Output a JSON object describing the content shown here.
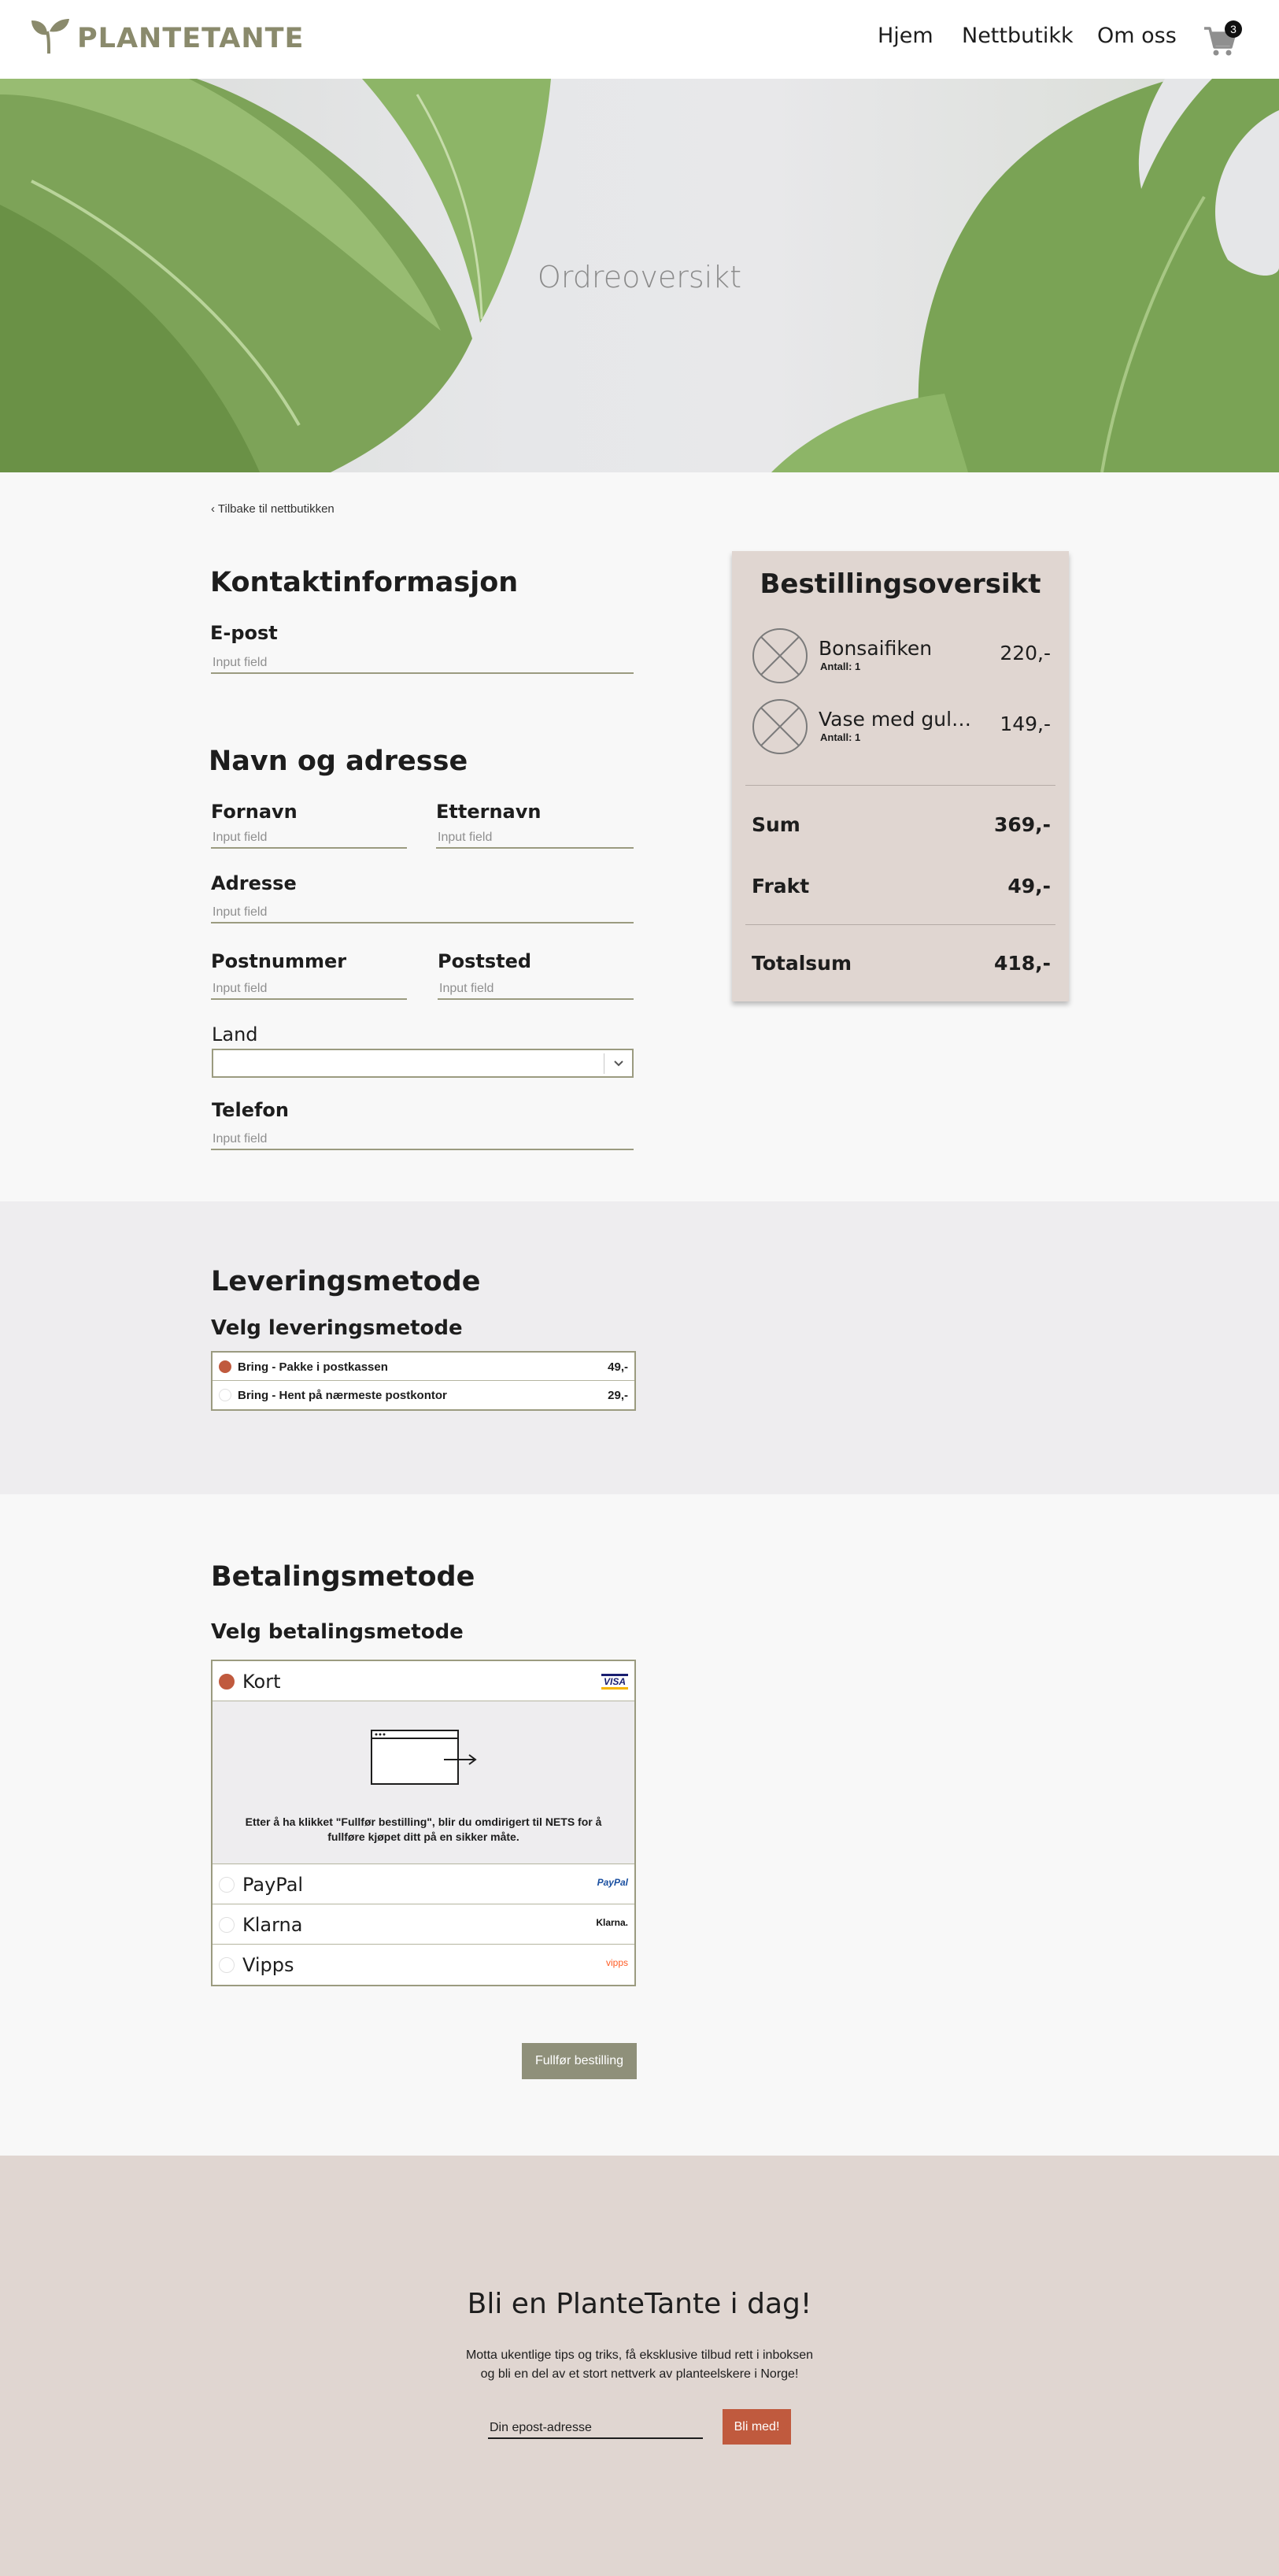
{
  "header": {
    "logo_text": "PLANTETANTE",
    "nav": [
      {
        "label": "Hjem"
      },
      {
        "label": "Nettbutikk"
      },
      {
        "label": "Om oss"
      }
    ],
    "cart_count": "3"
  },
  "hero": {
    "title": "Ordreoversikt"
  },
  "back_link": "Tilbake til nettbutikken",
  "contact": {
    "heading": "Kontaktinformasjon",
    "email_label": "E-post",
    "email_placeholder": "Input field"
  },
  "address": {
    "heading": "Navn og adresse",
    "first_name_label": "Fornavn",
    "last_name_label": "Etternavn",
    "address_label": "Adresse",
    "postal_code_label": "Postnummer",
    "city_label": "Poststed",
    "country_label": "Land",
    "phone_label": "Telefon",
    "placeholder": "Input field"
  },
  "summary": {
    "title": "Bestillingsoversikt",
    "items": [
      {
        "name": "Bonsaifiken",
        "qty": "Antall: 1",
        "price": "220,-"
      },
      {
        "name": "Vase med gull...",
        "qty": "Antall: 1",
        "price": "149,-"
      }
    ],
    "sum_label": "Sum",
    "sum_value": "369,-",
    "shipping_label": "Frakt",
    "shipping_value": "49,-",
    "total_label": "Totalsum",
    "total_value": "418,-"
  },
  "delivery": {
    "heading": "Leveringsmetode",
    "subheading": "Velg leveringsmetode",
    "options": [
      {
        "label": "Bring - Pakke i postkassen",
        "price": "49,-",
        "selected": true
      },
      {
        "label": "Bring - Hent på nærmeste postkontor",
        "price": "29,-",
        "selected": false
      }
    ]
  },
  "payment": {
    "heading": "Betalingsmetode",
    "subheading": "Velg betalingsmetode",
    "card_label": "Kort",
    "card_logo": "VISA",
    "card_info": "Etter å ha klikket \"Fullfør bestilling\", blir du omdirigert til NETS for å fullføre kjøpet ditt på en sikker måte.",
    "others": [
      {
        "label": "PayPal",
        "logo": "PayPal"
      },
      {
        "label": "Klarna",
        "logo": "Klarna."
      },
      {
        "label": "Vipps",
        "logo": "vipps"
      }
    ],
    "submit_label": "Fullfør bestilling"
  },
  "footer": {
    "title": "Bli en PlanteTante i dag!",
    "text_line1": "Motta ukentlige tips og triks, få eksklusive tilbud rett i inboksen",
    "text_line2": "og bli en del av et stort nettverk av planteelskere i Norge!",
    "email_placeholder": "Din epost-adresse",
    "button_label": "Bli med!"
  },
  "colors": {
    "accent": "#c05a3e",
    "olive": "#8f907a",
    "summary_bg": "#e0d6d1"
  }
}
